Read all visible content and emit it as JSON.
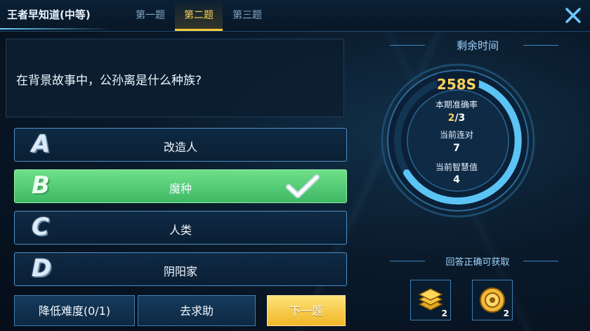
{
  "header": {
    "title": "王者早知道(中等)",
    "tabs": [
      {
        "label": "第一题",
        "active": false
      },
      {
        "label": "第二题",
        "active": true
      },
      {
        "label": "第三题",
        "active": false
      }
    ],
    "close_icon": "close-icon"
  },
  "question": {
    "text": "在背景故事中，公孙离是什么种族?"
  },
  "answers": [
    {
      "letter": "A",
      "text": "改造人",
      "correct": false
    },
    {
      "letter": "B",
      "text": "魔种",
      "correct": true
    },
    {
      "letter": "C",
      "text": "人类",
      "correct": false
    },
    {
      "letter": "D",
      "text": "阴阳家",
      "correct": false
    }
  ],
  "buttons": {
    "lower_difficulty": "降低难度(0/1)",
    "ask_help": "去求助",
    "next": "下一题"
  },
  "timer": {
    "header": "剩余时间",
    "seconds": "258S",
    "accuracy_label": "本期准确率",
    "accuracy_correct": "2",
    "accuracy_total": "/3",
    "streak_label": "当前连对",
    "streak_value": "7",
    "wisdom_label": "当前智慧值",
    "wisdom_value": "4"
  },
  "rewards": {
    "header": "回答正确可获取",
    "items": [
      {
        "icon": "coin-stack-icon",
        "count": "2"
      },
      {
        "icon": "medal-icon",
        "count": "2"
      }
    ]
  },
  "colors": {
    "accent_gold": "#ffd25a",
    "correct_green": "#4cc870",
    "panel_blue": "#0f2a44"
  }
}
